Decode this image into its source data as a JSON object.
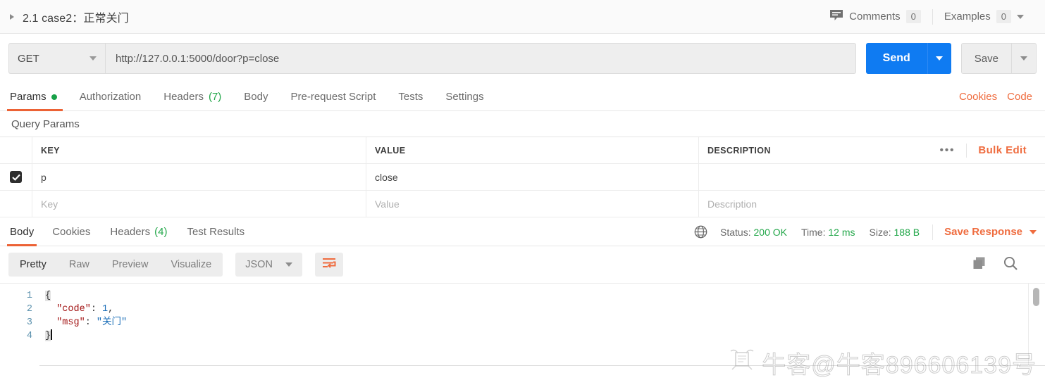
{
  "titlebar": {
    "collapse_icon": "triangle-right-icon",
    "request_title": "2.1 case2：正常关门",
    "comments_label": "Comments",
    "comments_count": "0",
    "examples_label": "Examples",
    "examples_count": "0"
  },
  "urlbar": {
    "method": "GET",
    "url": "http://127.0.0.1:5000/door?p=close",
    "send_label": "Send",
    "save_label": "Save",
    "send_color": "#0f7bf2"
  },
  "request_tabs": {
    "items": [
      {
        "label": "Params",
        "badge": "",
        "has_dot": true,
        "active": true
      },
      {
        "label": "Authorization",
        "badge": "",
        "has_dot": false,
        "active": false
      },
      {
        "label": "Headers",
        "badge": "(7)",
        "has_dot": false,
        "active": false
      },
      {
        "label": "Body",
        "badge": "",
        "has_dot": false,
        "active": false
      },
      {
        "label": "Pre-request Script",
        "badge": "",
        "has_dot": false,
        "active": false
      },
      {
        "label": "Tests",
        "badge": "",
        "has_dot": false,
        "active": false
      },
      {
        "label": "Settings",
        "badge": "",
        "has_dot": false,
        "active": false
      }
    ],
    "cookies_label": "Cookies",
    "code_label": "Code",
    "accent_color": "#ec6235"
  },
  "query_params": {
    "section_label": "Query Params",
    "columns": [
      "KEY",
      "VALUE",
      "DESCRIPTION"
    ],
    "more_label": "•••",
    "bulk_edit_label": "Bulk Edit",
    "rows": [
      {
        "checked": true,
        "key": "p",
        "value": "close",
        "description": ""
      }
    ],
    "placeholder_row": {
      "key_placeholder": "Key",
      "value_placeholder": "Value",
      "description_placeholder": "Description"
    }
  },
  "response": {
    "tabs": [
      {
        "label": "Body",
        "badge": "",
        "active": true
      },
      {
        "label": "Cookies",
        "badge": "",
        "active": false
      },
      {
        "label": "Headers",
        "badge": "(4)",
        "active": false
      },
      {
        "label": "Test Results",
        "badge": "",
        "active": false
      }
    ],
    "status_label": "Status:",
    "status_value": "200 OK",
    "time_label": "Time:",
    "time_value": "12 ms",
    "size_label": "Size:",
    "size_value": "188 B",
    "save_response_label": "Save Response",
    "ok_color": "#23a74a"
  },
  "body_viewer": {
    "modes": [
      {
        "label": "Pretty",
        "active": true
      },
      {
        "label": "Raw",
        "active": false
      },
      {
        "label": "Preview",
        "active": false
      },
      {
        "label": "Visualize",
        "active": false
      }
    ],
    "format": "JSON",
    "wrap_icon": "word-wrap-icon",
    "copy_icon": "copy-icon",
    "search_icon": "search-icon"
  },
  "code": {
    "line_numbers": [
      "1",
      "2",
      "3",
      "4"
    ],
    "lines": [
      {
        "open_brace": "{"
      },
      {
        "indent": "  ",
        "key": "\"code\"",
        "colon": ": ",
        "num": "1",
        "comma": ","
      },
      {
        "indent": "  ",
        "key": "\"msg\"",
        "colon": ": ",
        "str": "\"关门\""
      },
      {
        "close_brace": "}"
      }
    ],
    "raw": "{\n  \"code\": 1,\n  \"msg\": \"关门\"\n}"
  },
  "watermark": {
    "text": "牛客@牛客896606139号"
  }
}
